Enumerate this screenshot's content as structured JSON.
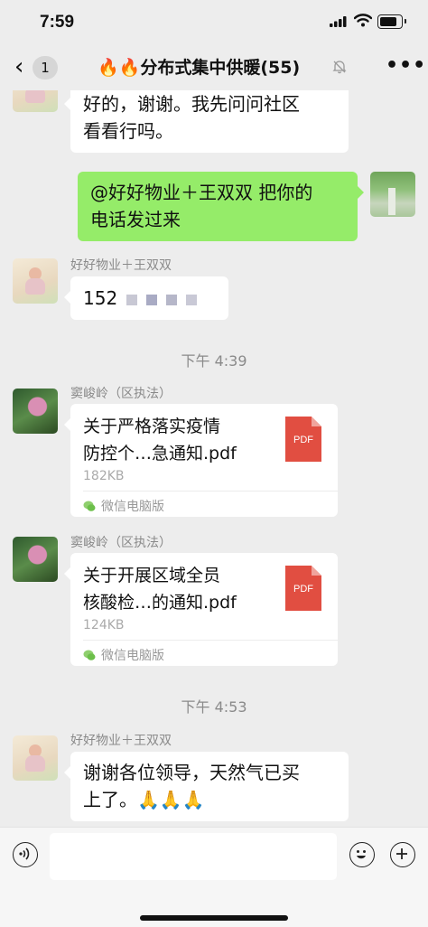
{
  "status_bar": {
    "time": "7:59"
  },
  "nav": {
    "back_glyph": "‹",
    "unread_count": "1",
    "title": "🔥🔥分布式集中供暖(55)",
    "more_glyph": "•••"
  },
  "messages": [
    {
      "type": "text",
      "side": "left",
      "text_line1": "好的，谢谢。我先问问社区",
      "text_line2": "看看行吗。"
    },
    {
      "type": "text",
      "side": "right",
      "text_line1": "@好好物业＋王双双 把你的",
      "text_line2": "电话发过来"
    },
    {
      "type": "text",
      "side": "left",
      "sender": "好好物业＋王双双",
      "text": "152"
    },
    {
      "type": "timestamp",
      "text": "下午 4:39"
    },
    {
      "type": "file",
      "sender": "窦峻岭（区执法）",
      "name_line1": "关于严格落实疫情",
      "name_line2": "防控个…急通知.pdf",
      "size": "182KB",
      "source": "微信电脑版",
      "icon_label": "PDF"
    },
    {
      "type": "file",
      "sender": "窦峻岭（区执法）",
      "name_line1": "关于开展区域全员",
      "name_line2": "核酸检…的通知.pdf",
      "size": "124KB",
      "source": "微信电脑版",
      "icon_label": "PDF"
    },
    {
      "type": "timestamp",
      "text": "下午 4:53"
    },
    {
      "type": "text",
      "side": "left",
      "sender": "好好物业＋王双双",
      "text_line1": "谢谢各位领导，天然气已买",
      "text_line2": "上了。🙏🙏🙏"
    }
  ],
  "colors": {
    "background": "#ededed",
    "bubble_self": "#95ec69",
    "bubble_other": "#ffffff",
    "pdf_icon": "#e14e41"
  },
  "icons": [
    "back-icon",
    "mute-icon",
    "more-icon",
    "voice-icon",
    "emoji-icon",
    "add-icon",
    "pdf-icon",
    "wechat-pc-icon"
  ]
}
